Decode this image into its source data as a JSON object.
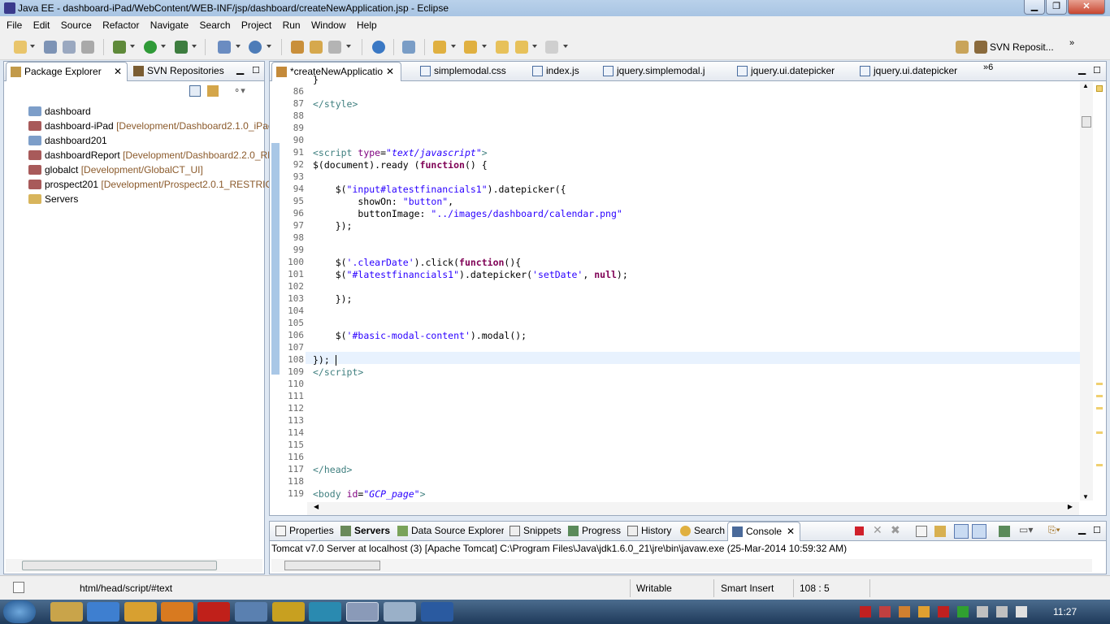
{
  "window": {
    "title": "Java EE - dashboard-iPad/WebContent/WEB-INF/jsp/dashboard/createNewApplication.jsp - Eclipse",
    "min": "▁",
    "max": "❐",
    "close": "✕"
  },
  "menu": [
    "File",
    "Edit",
    "Source",
    "Refactor",
    "Navigate",
    "Search",
    "Project",
    "Run",
    "Window",
    "Help"
  ],
  "perspective": {
    "label": "SVN Reposit...",
    "more": "»"
  },
  "left_tabs": {
    "package_explorer": "Package Explorer",
    "svn": "SVN Repositories"
  },
  "tree": [
    {
      "name": "dashboard",
      "decoration": ""
    },
    {
      "name": "dashboard-iPad",
      "decoration": "[Development/Dashboard2.1.0_iPac"
    },
    {
      "name": "dashboard201",
      "decoration": ""
    },
    {
      "name": "dashboardReport",
      "decoration": "[Development/Dashboard2.2.0_RE"
    },
    {
      "name": "globalct",
      "decoration": "[Development/GlobalCT_UI]"
    },
    {
      "name": "prospect201",
      "decoration": "[Development/Prospect2.0.1_RESTRICT"
    },
    {
      "name": "Servers",
      "decoration": ""
    }
  ],
  "editor_tabs": [
    "*createNewApplicatio",
    "simplemodal.css",
    "index.js",
    "jquery.simplemodal.j",
    "jquery.ui.datepicker",
    "jquery.ui.datepicker"
  ],
  "editor_more": "»6",
  "code_lines": [
    "86",
    "87",
    "88",
    "89",
    "90",
    "91",
    "92",
    "93",
    "94",
    "95",
    "96",
    "97",
    "98",
    "99",
    "100",
    "101",
    "102",
    "103",
    "104",
    "105",
    "106",
    "107",
    "108",
    "109",
    "110",
    "111",
    "112",
    "113",
    "114",
    "115",
    "116",
    "117",
    "118",
    "119"
  ],
  "bottom_tabs": [
    "Properties",
    "Servers",
    "Data Source Explorer",
    "Snippets",
    "Progress",
    "History",
    "Search",
    "Console"
  ],
  "console_text": "Tomcat v7.0 Server at localhost (3) [Apache Tomcat] C:\\Program Files\\Java\\jdk1.6.0_21\\jre\\bin\\javaw.exe (25-Mar-2014 10:59:32 AM)",
  "status": {
    "path": "html/head/script/#text",
    "writable": "Writable",
    "insert": "Smart Insert",
    "pos": "108 : 5"
  },
  "clock": "11:27"
}
